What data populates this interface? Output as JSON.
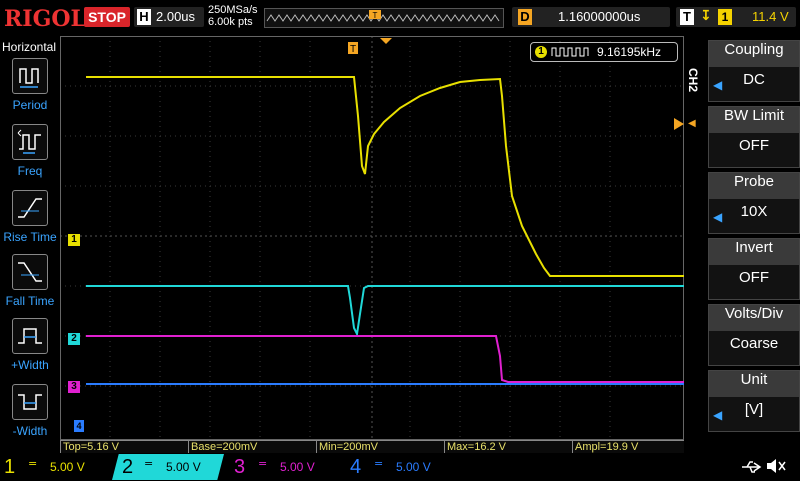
{
  "topbar": {
    "logo": "RIGOL",
    "run_state": "STOP",
    "horizontal_key": "H",
    "timebase": "2.00us",
    "sample_rate": "250MSa/s",
    "memory_depth": "6.00k pts",
    "delay_key": "D",
    "delay": "1.16000000us",
    "trigger_key": "T",
    "trigger_source": "1",
    "trigger_level": "11.4 V"
  },
  "left_panel": {
    "title": "Horizontal",
    "items": [
      {
        "label": "Period",
        "icon": "period-icon"
      },
      {
        "label": "Freq",
        "icon": "frequency-icon"
      },
      {
        "label": "Rise Time",
        "icon": "rise-time-icon"
      },
      {
        "label": "Fall Time",
        "icon": "fall-time-icon"
      },
      {
        "label": "+Width",
        "icon": "positive-width-icon"
      },
      {
        "label": "-Width",
        "icon": "negative-width-icon"
      }
    ]
  },
  "frequency_counter": {
    "channel": "1",
    "value": "9.16195kHz"
  },
  "right_panel": {
    "channel_tag": "CH2",
    "menus": [
      {
        "title": "Coupling",
        "value": "DC"
      },
      {
        "title": "BW Limit",
        "value": "OFF"
      },
      {
        "title": "Probe",
        "value": "10X"
      },
      {
        "title": "Invert",
        "value": "OFF"
      },
      {
        "title": "Volts/Div",
        "value": "Coarse"
      },
      {
        "title": "Unit",
        "value": "[V]"
      }
    ]
  },
  "measurements": [
    {
      "text": "Top=5.16 V"
    },
    {
      "text": "Base=200mV"
    },
    {
      "text": "Min=200mV"
    },
    {
      "text": "Max=16.2 V"
    },
    {
      "text": "Ampl=19.9 V"
    }
  ],
  "channel_markers": [
    "1",
    "2",
    "3",
    "4"
  ],
  "channels": [
    {
      "num": "1",
      "coupling": "=",
      "scale": "5.00 V",
      "color": "#e8e000"
    },
    {
      "num": "2",
      "coupling": "=",
      "scale": "5.00 V",
      "color": "#20d8d8"
    },
    {
      "num": "3",
      "coupling": "=",
      "scale": "5.00 V",
      "color": "#e020d0"
    },
    {
      "num": "4",
      "coupling": "=",
      "scale": "5.00 V",
      "color": "#2a7cff"
    }
  ],
  "colors": {
    "ch1": "#e8e000",
    "ch2": "#20d8d8",
    "ch3": "#e020d0",
    "ch4": "#2a7cff",
    "trigger": "#f5a623",
    "accent": "#3aa4ff"
  },
  "status_icons": [
    "usb-icon",
    "speaker-muted-icon"
  ]
}
